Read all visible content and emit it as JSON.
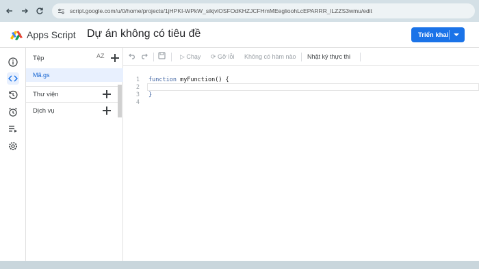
{
  "browser": {
    "url": "script.google.com/u/0/home/projects/1jHPKI-WPkW_sikjvlOSFOdKHZJCFHmMEeglioohLcEPARRR_lLZZS3wmu/edit"
  },
  "header": {
    "app_name": "Apps Script",
    "project_title": "Dự án không có tiêu đề",
    "deploy_label": "Triển khai"
  },
  "files_panel": {
    "title": "Tệp",
    "sort_label": "AZ",
    "file": "Mã.gs",
    "libraries": "Thư viện",
    "services": "Dịch vụ"
  },
  "toolbar": {
    "run": "Chạy",
    "debug": "Gỡ lỗi",
    "no_function": "Không có hàm nào",
    "execution_log": "Nhật ký thực thi"
  },
  "code": {
    "line_numbers": [
      "1",
      "2",
      "3",
      "4"
    ],
    "line1_keyword": "function",
    "line1_rest": " myFunction() {",
    "line3": "}"
  },
  "colors": {
    "accent": "#1a73e8",
    "selected_file_bg": "#e8f0fe"
  }
}
